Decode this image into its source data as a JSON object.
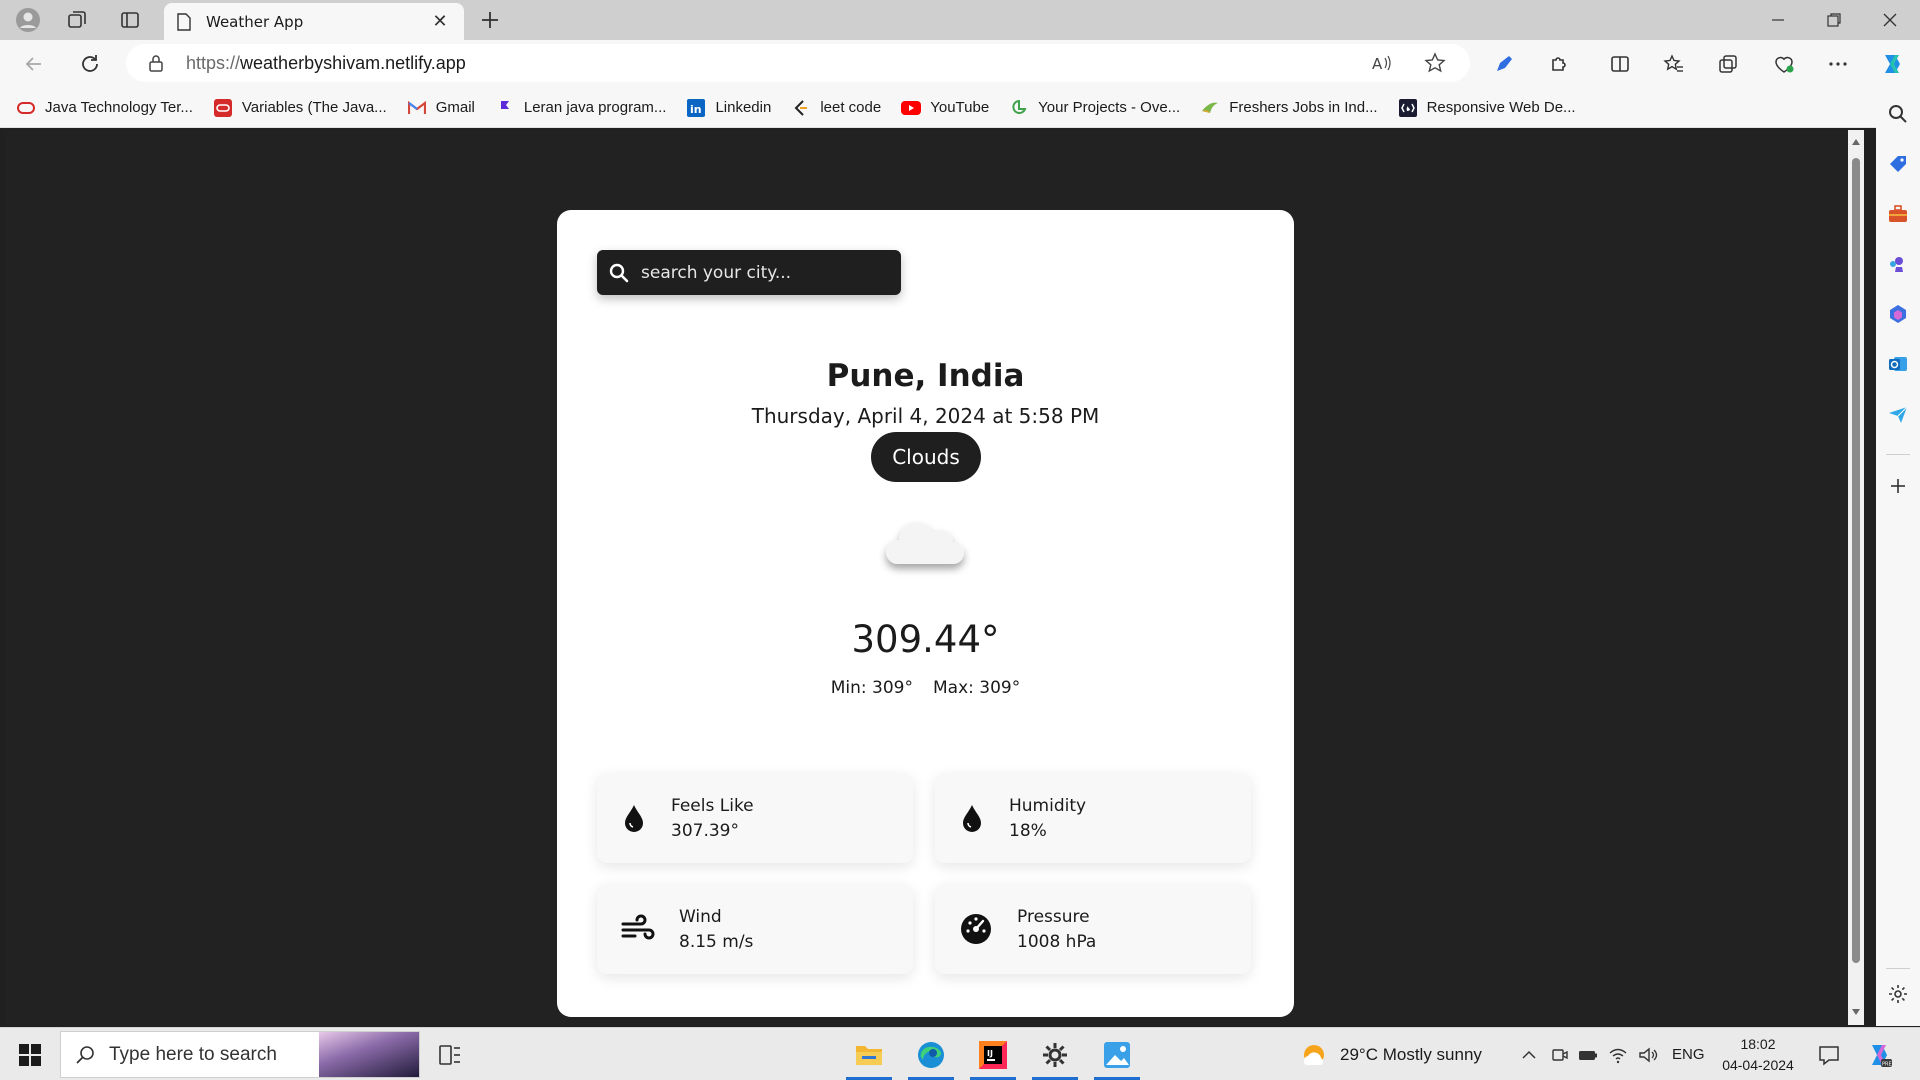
{
  "browser": {
    "tab_title": "Weather App",
    "url_prefix": "https://",
    "url_host": "weatherbyshivam.netlify.app",
    "bookmarks": [
      {
        "label": "Java Technology Ter...",
        "icon": "oracle-icon"
      },
      {
        "label": "Variables (The Java...",
        "icon": "oracle-red-icon"
      },
      {
        "label": "Gmail",
        "icon": "gmail-icon"
      },
      {
        "label": "Leran java program...",
        "icon": "flag-icon"
      },
      {
        "label": "Linkedin",
        "icon": "linkedin-icon"
      },
      {
        "label": "leet code",
        "icon": "leetcode-icon"
      },
      {
        "label": "YouTube",
        "icon": "youtube-icon"
      },
      {
        "label": "Your Projects - Ove...",
        "icon": "projects-icon"
      },
      {
        "label": "Freshers Jobs in Ind...",
        "icon": "jobs-icon"
      },
      {
        "label": "Responsive Web De...",
        "icon": "freecodecamp-icon"
      }
    ]
  },
  "weather": {
    "search_placeholder": "search your city...",
    "city": "Pune, India",
    "datetime": "Thursday, April 4, 2024 at 5:58 PM",
    "condition": "Clouds",
    "condition_icon": "cloud-icon",
    "temperature": "309.44°",
    "min": "Min: 309°",
    "max": "Max: 309°",
    "stats": {
      "feels_like": {
        "label": "Feels Like",
        "value": "307.39°",
        "icon": "droplet-icon"
      },
      "humidity": {
        "label": "Humidity",
        "value": "18%",
        "icon": "droplet-icon"
      },
      "wind": {
        "label": "Wind",
        "value": "8.15 m/s",
        "icon": "wind-icon"
      },
      "pressure": {
        "label": "Pressure",
        "value": "1008 hPa",
        "icon": "gauge-icon"
      }
    }
  },
  "taskbar": {
    "search_placeholder": "Type here to search",
    "weather": "29°C  Mostly sunny",
    "language": "ENG",
    "time": "18:02",
    "date": "04-04-2024"
  },
  "colors": {
    "page_bg": "#222222",
    "card_bg": "#ffffff",
    "dark_pill": "#1f1f1f",
    "edge_accent": "#1f6fd1"
  }
}
